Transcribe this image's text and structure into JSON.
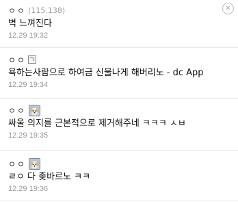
{
  "comments": [
    {
      "nick": "ㅇㅇ",
      "ip": "(115.138)",
      "text": "벽 느껴진다",
      "date": "12.29 19:32",
      "icon": "none"
    },
    {
      "nick": "ㅇㅇ",
      "ip": "",
      "text": "욕하는사람으로 하여금 신물나게 해버리노 - dc App",
      "date": "12.29 19:34",
      "icon": "gallog-icon"
    },
    {
      "nick": "ㅇㅇ",
      "ip": "",
      "text": "싸울 의지를 근본적으로 제거해주네 ㅋㅋㅋ ㅅㅂ",
      "date": "12.29 19:35",
      "icon": "dog-avatar-icon"
    },
    {
      "nick": "ㅇㅇ",
      "ip": "",
      "text": "ㄹㅇ 다 좆바르노 ㅋㅋ",
      "date": "12.29 19:36",
      "icon": "dog-avatar-icon"
    }
  ],
  "colors": {
    "text": "#111111",
    "meta": "#999999",
    "divider": "#e8e8e8"
  }
}
